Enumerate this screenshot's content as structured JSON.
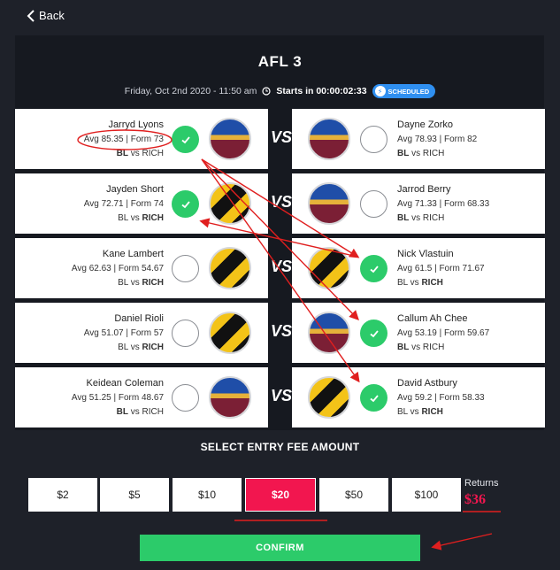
{
  "nav": {
    "back_label": "Back"
  },
  "contest": {
    "title": "AFL 3",
    "date": "Friday, Oct 2nd 2020 - 11:50 am",
    "starts_label": "Starts in",
    "countdown": "00:00:02:33",
    "status_badge": "SCHEDULED"
  },
  "matchups": [
    {
      "left": {
        "name": "Jarryd Lyons",
        "stats": "Avg 85.35 | Form 73",
        "team": "BL",
        "opp": "RICH",
        "bold_side": "left",
        "logo": "bl",
        "selected": true
      },
      "right": {
        "name": "Dayne Zorko",
        "stats": "Avg 78.93 | Form 82",
        "team": "BL",
        "opp": "RICH",
        "bold_side": "left",
        "logo": "bl",
        "selected": false
      }
    },
    {
      "left": {
        "name": "Jayden Short",
        "stats": "Avg 72.71 | Form 74",
        "team": "BL",
        "opp": "RICH",
        "bold_side": "right",
        "logo": "rich",
        "selected": true
      },
      "right": {
        "name": "Jarrod Berry",
        "stats": "Avg 71.33 | Form 68.33",
        "team": "BL",
        "opp": "RICH",
        "bold_side": "left",
        "logo": "bl",
        "selected": false
      }
    },
    {
      "left": {
        "name": "Kane Lambert",
        "stats": "Avg 62.63 | Form 54.67",
        "team": "BL",
        "opp": "RICH",
        "bold_side": "right",
        "logo": "rich",
        "selected": false
      },
      "right": {
        "name": "Nick Vlastuin",
        "stats": "Avg 61.5 | Form 71.67",
        "team": "BL",
        "opp": "RICH",
        "bold_side": "right",
        "logo": "rich",
        "selected": true
      }
    },
    {
      "left": {
        "name": "Daniel Rioli",
        "stats": "Avg 51.07 | Form 57",
        "team": "BL",
        "opp": "RICH",
        "bold_side": "right",
        "logo": "rich",
        "selected": false
      },
      "right": {
        "name": "Callum Ah Chee",
        "stats": "Avg 53.19 | Form 59.67",
        "team": "BL",
        "opp": "RICH",
        "bold_side": "left",
        "logo": "bl",
        "selected": true
      }
    },
    {
      "left": {
        "name": "Keidean Coleman",
        "stats": "Avg 51.25 | Form 48.67",
        "team": "BL",
        "opp": "RICH",
        "bold_side": "left",
        "logo": "bl",
        "selected": false
      },
      "right": {
        "name": "David Astbury",
        "stats": "Avg 59.2 | Form 58.33",
        "team": "BL",
        "opp": "RICH",
        "bold_side": "right",
        "logo": "rich",
        "selected": true
      }
    }
  ],
  "vs_label": "VS",
  "vs_word": "vs",
  "entry": {
    "title": "SELECT ENTRY FEE AMOUNT",
    "options": [
      "$2",
      "$5",
      "$10",
      "$20",
      "$50",
      "$100"
    ],
    "selected": "$20",
    "returns_label": "Returns",
    "returns_value": "$36"
  },
  "confirm_label": "CONFIRM",
  "colors": {
    "accent_green": "#2ccb6a",
    "accent_pink": "#f2164f",
    "badge_blue": "#2f8ff0",
    "annotation_red": "#e01f1f",
    "background": "#1e2129"
  },
  "icons": {
    "back": "chevron-left-icon",
    "clock": "clock-icon",
    "status": "bolt-icon",
    "check": "check-icon"
  }
}
